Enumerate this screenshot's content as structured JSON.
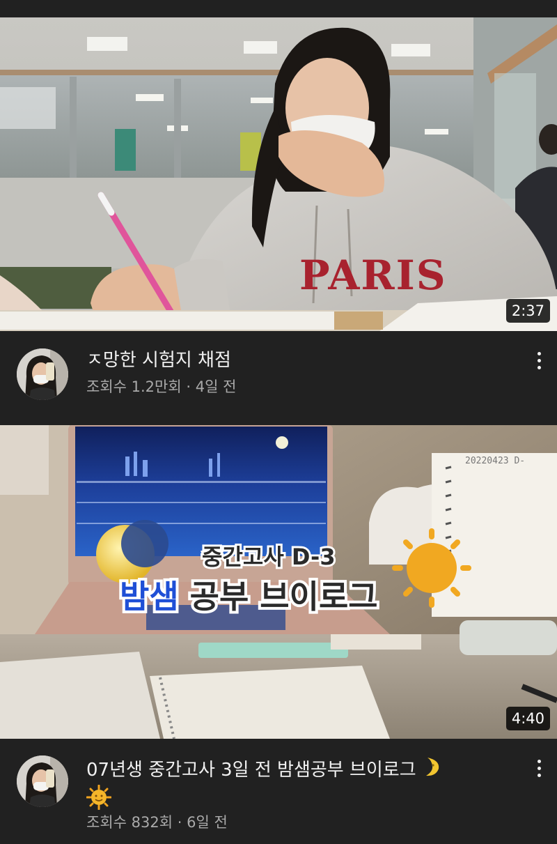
{
  "videos": [
    {
      "title": "ㅈ망한 시험지 채점",
      "views": "조회수 1.2만회",
      "separator": "·",
      "age": "4일 전",
      "duration": "2:37",
      "thumbnail_hoodie_text": "PARIS",
      "channel_avatar_icon": "avatar-icon"
    },
    {
      "title": "07년생 중간고사 3일 전 밤샘공부 브이로그",
      "title_emojis": [
        "crescent-moon-icon",
        "sun-face-icon"
      ],
      "views": "조회수 832회",
      "separator": "·",
      "age": "6일 전",
      "duration": "4:40",
      "thumbnail_overlay_line1": "중간고사 D-3",
      "thumbnail_overlay_line2_accent": "밤샘",
      "thumbnail_overlay_line2_rest": " 공부 브이로그",
      "thumbnail_notebook_text": "20220423 D-",
      "channel_avatar_icon": "avatar-icon"
    }
  ],
  "colors": {
    "background": "#212121",
    "title_text": "#f1f1f1",
    "meta_text": "#aaaaaa",
    "overlay_accent": "#1f4fd6"
  }
}
